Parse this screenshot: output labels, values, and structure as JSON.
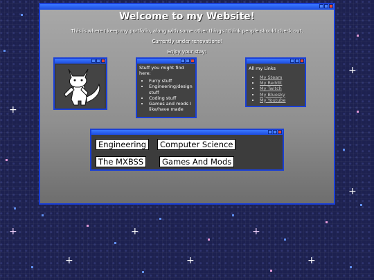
{
  "main_window": {
    "title": "Welcome to my Website!",
    "intro": "This is where I keep my portfolio, along with some other things I think people should check out.",
    "status": "Currently under renovations!",
    "closing": "Enjoy your stay!"
  },
  "stuff_window": {
    "heading": "Stuff you might find here:",
    "items": [
      "Furry stuff",
      "Engineering/design stuff",
      "Coding stuff",
      "Games and mods I like/have made"
    ]
  },
  "links_window": {
    "heading": "All my Links",
    "links": [
      "My Steam",
      "My Reddit",
      "My Twitch",
      "My Bluesky",
      "My Youtube"
    ]
  },
  "nav_window": {
    "buttons": [
      "Engineering",
      "Computer Science",
      "The MXBSS",
      "Games And Mods"
    ]
  },
  "art_window": {
    "image": "white-fox-character-drawing"
  },
  "colors": {
    "window_border": "#1a3fd6",
    "titlebar": "#2f66f0",
    "close_button": "#e34a2f",
    "background": "#1d2150"
  }
}
